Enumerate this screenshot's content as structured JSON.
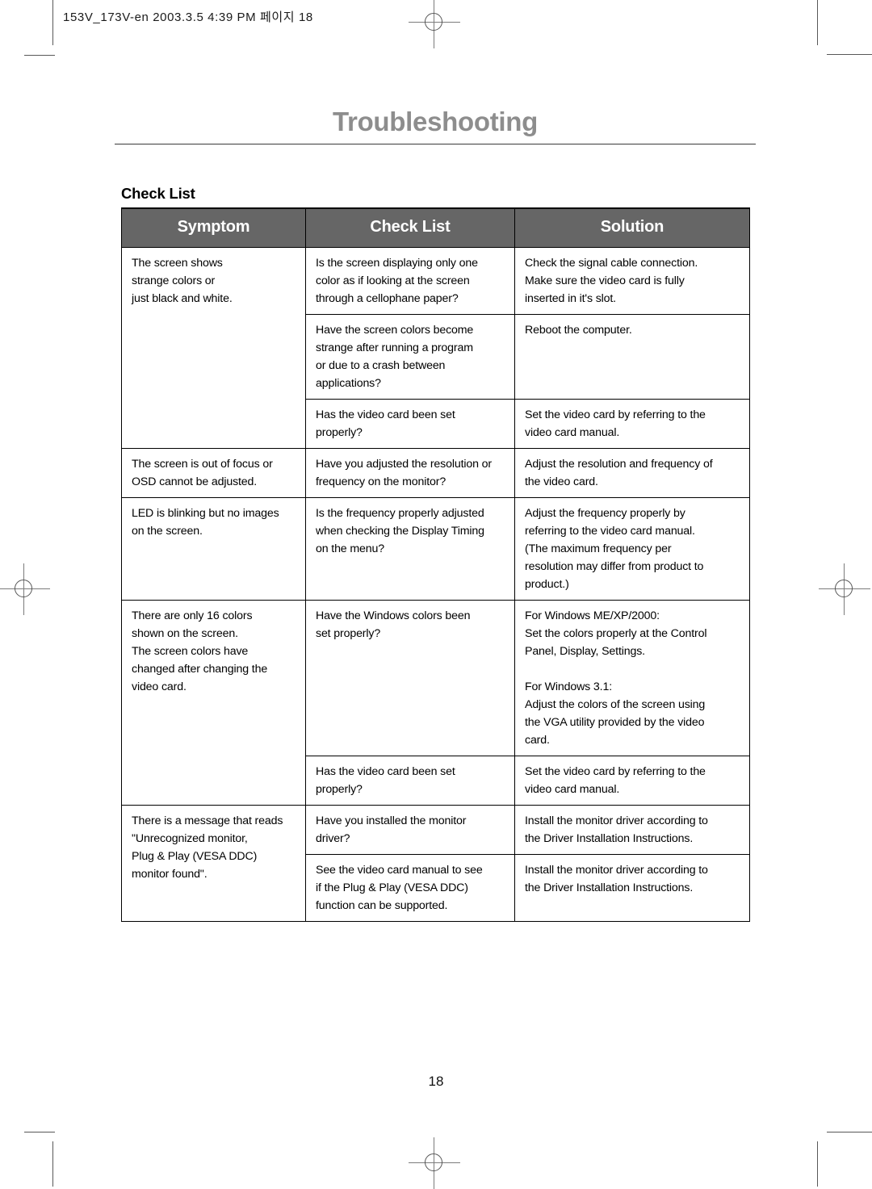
{
  "slug": {
    "text": "153V_173V-en  2003.3.5 4:39 PM 페이지 18"
  },
  "chapter": {
    "title": "Troubleshooting"
  },
  "section": {
    "heading": "Check List"
  },
  "table": {
    "headers": [
      "Symptom",
      "Check List",
      "Solution"
    ],
    "rows": [
      {
        "symptom": "The screen shows\nstrange colors or\njust black and white.",
        "symptom_rowspan": 3,
        "check": "Is the screen displaying only one\ncolor as if looking at the screen\nthrough a cellophane paper?",
        "solution": "Check the signal cable connection.\nMake sure the video card is fully\ninserted in it's slot."
      },
      {
        "check": "Have the screen colors become\nstrange after running a program\nor due to a crash between\napplications?",
        "solution": "Reboot the computer."
      },
      {
        "check": "Has the video card been set\nproperly?",
        "solution": "Set the video card by referring to the\nvideo card manual."
      },
      {
        "symptom": "The screen is out of focus or\nOSD cannot be adjusted.",
        "symptom_rowspan": 1,
        "check": "Have you adjusted the resolution or\nfrequency on the monitor?",
        "solution": "Adjust the resolution and frequency of\nthe video card."
      },
      {
        "symptom": "LED is blinking but no images\non the screen.",
        "symptom_rowspan": 1,
        "check": "Is the frequency properly adjusted\nwhen checking the Display Timing\non the menu?",
        "solution": "Adjust the frequency properly by\nreferring to the video card manual.\n(The maximum frequency per\nresolution may differ from product to\nproduct.)"
      },
      {
        "symptom": "There are only 16 colors\nshown on the screen.\nThe screen colors have\nchanged after changing the\nvideo card.",
        "symptom_rowspan": 2,
        "check": "Have the Windows colors been\nset properly?",
        "solution": "For Windows ME/XP/2000:\nSet the colors properly at the Control\nPanel, Display, Settings.\n\nFor Windows 3.1:\nAdjust the colors of the screen using\nthe VGA utility provided by the video\ncard."
      },
      {
        "check": "Has the video card been set\nproperly?",
        "solution": "Set the video card by referring to the\nvideo card manual."
      },
      {
        "symptom": "There is a message that reads\n\"Unrecognized monitor,\nPlug & Play (VESA DDC)\nmonitor found\".",
        "symptom_rowspan": 2,
        "check": "Have you installed the monitor\ndriver?",
        "solution": "Install the monitor driver according to\nthe Driver Installation Instructions."
      },
      {
        "check": "See the video card manual to see\nif the Plug & Play (VESA DDC)\nfunction can be supported.",
        "solution": "Install the monitor driver according to\nthe Driver Installation Instructions."
      }
    ]
  },
  "footer": {
    "page_number": "18"
  },
  "colors": {
    "header_fill": "#666666",
    "header_text": "#ffffff",
    "chapter_title": "#8d8d8d",
    "body_text": "#000000",
    "rule": "#3a3a3a",
    "mark": "#585858"
  }
}
